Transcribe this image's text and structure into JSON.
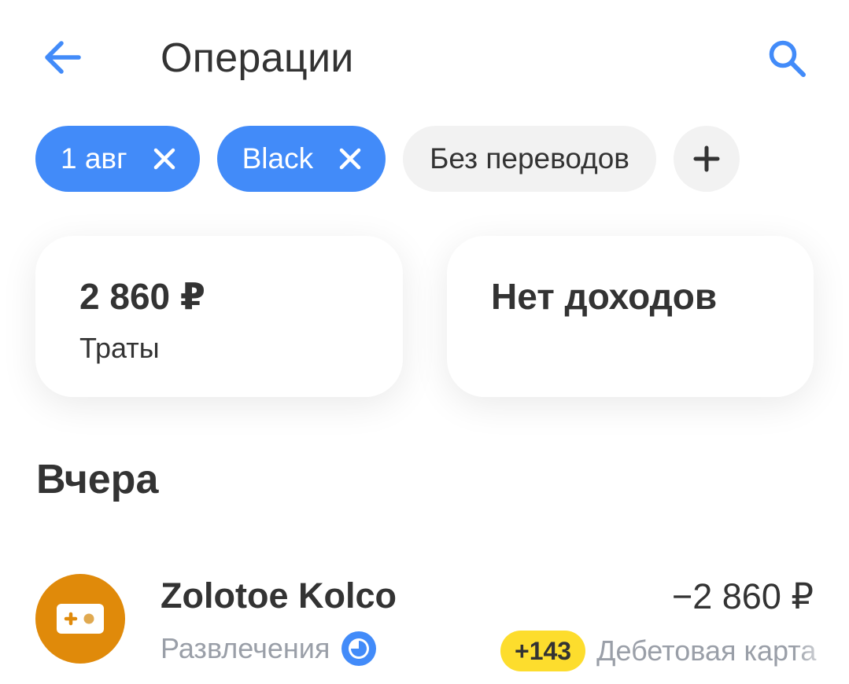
{
  "header": {
    "title": "Операции",
    "back_icon": "arrow-left-icon",
    "search_icon": "search-icon"
  },
  "filters": {
    "chips": [
      {
        "label": "1 авг",
        "active": true
      },
      {
        "label": "Black",
        "active": true
      },
      {
        "label": "Без переводов",
        "active": false
      }
    ],
    "add_label": "+"
  },
  "summary": {
    "spend": {
      "amount": "2 860 ₽",
      "caption": "Траты"
    },
    "income": {
      "amount": "Нет доходов"
    }
  },
  "section": {
    "title": "Вчера"
  },
  "operations": [
    {
      "name": "Zolotoe Kolco",
      "category": "Развлечения",
      "amount": "−2 860 ₽",
      "cashback": "+143",
      "account": "Дебетовая карта",
      "icon": "gamepad-icon"
    }
  ],
  "colors": {
    "accent": "#428bf9",
    "chip_inactive": "#f2f2f2",
    "avatar": "#e08a0a",
    "cashback": "#fddd2d",
    "muted_text": "#9a9fa8"
  }
}
